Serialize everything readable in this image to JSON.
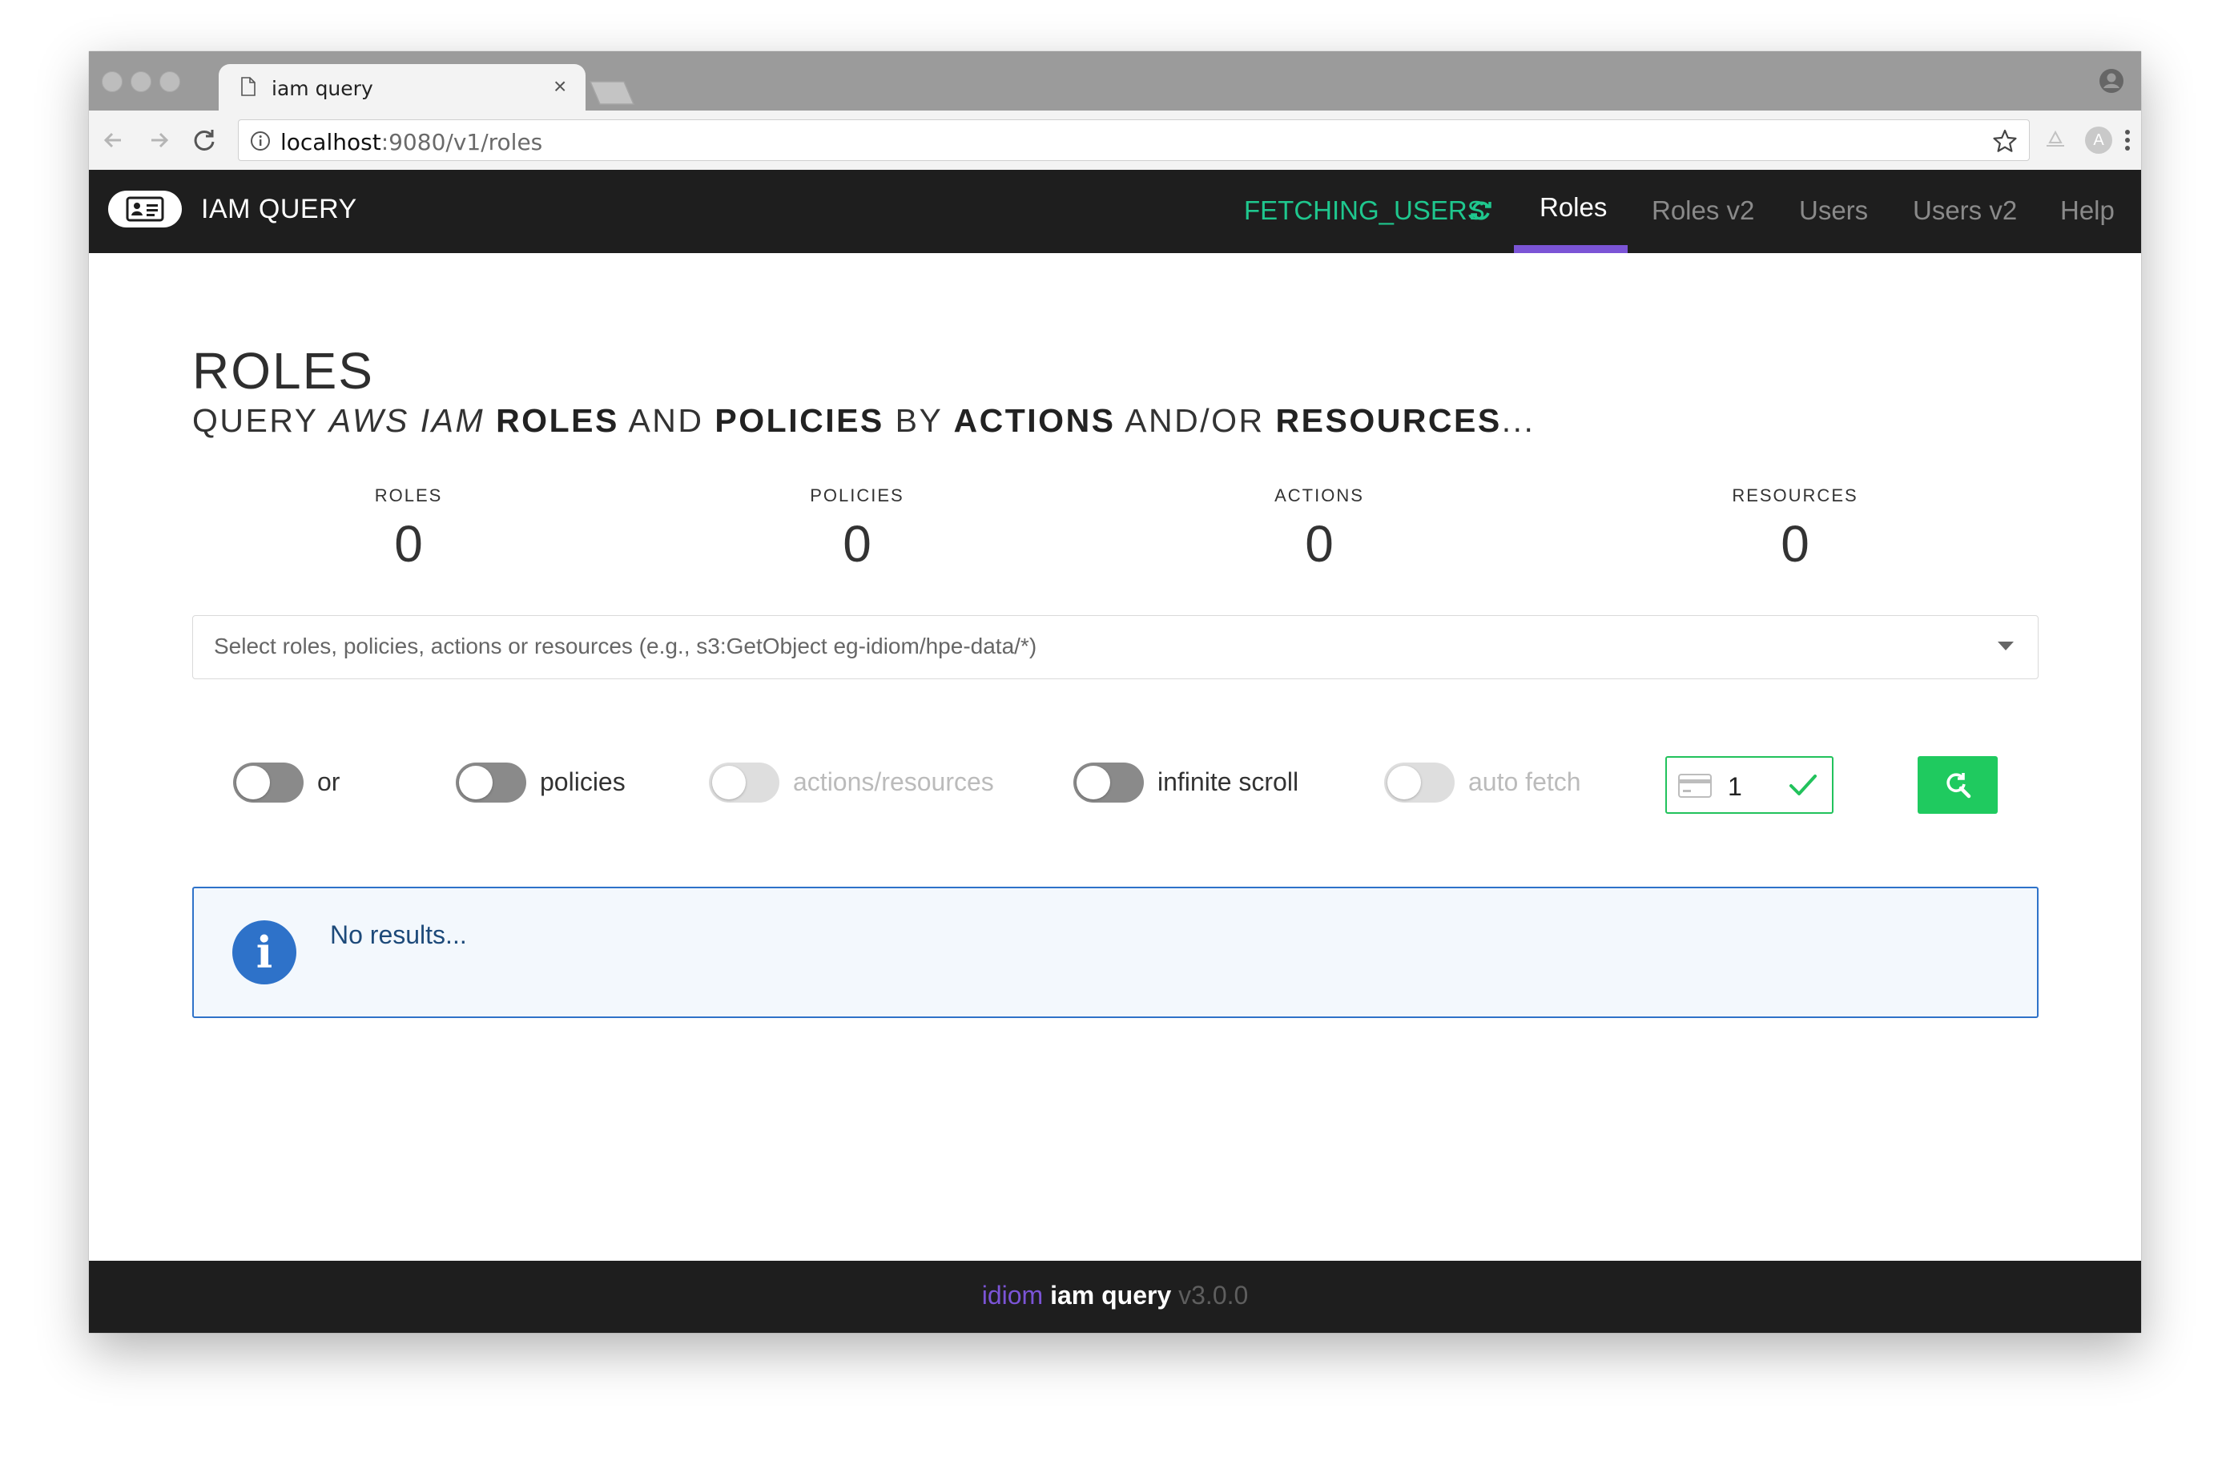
{
  "browser": {
    "tab_title": "iam query",
    "tab_close": "×",
    "url_host": "localhost",
    "url_path": ":9080/v1/roles",
    "profile_badge": "A"
  },
  "navbar": {
    "brand": "IAM QUERY",
    "status": "FETCHING_USERS",
    "items": [
      {
        "label": "Roles",
        "active": true
      },
      {
        "label": "Roles v2",
        "active": false
      },
      {
        "label": "Users",
        "active": false
      },
      {
        "label": "Users v2",
        "active": false
      },
      {
        "label": "Help",
        "active": false
      }
    ],
    "accent_color": "#7b54d6",
    "status_color": "#1fc78e"
  },
  "page": {
    "title": "ROLES",
    "subtitle": {
      "w1": "QUERY ",
      "w2": "AWS IAM",
      "w3": " ",
      "w4": "ROLES",
      "w5": " AND ",
      "w6": "POLICIES",
      "w7": " BY ",
      "w8": "ACTIONS",
      "w9": " AND/OR ",
      "w10": "RESOURCES",
      "w11": "..."
    }
  },
  "stats": [
    {
      "label": "ROLES",
      "value": "0"
    },
    {
      "label": "POLICIES",
      "value": "0"
    },
    {
      "label": "ACTIONS",
      "value": "0"
    },
    {
      "label": "RESOURCES",
      "value": "0"
    }
  ],
  "search": {
    "placeholder": "Select roles, policies, actions or resources (e.g., s3:GetObject eg-idiom/hpe-data/*)"
  },
  "toggles": [
    {
      "label": "or",
      "enabled": true,
      "on": false
    },
    {
      "label": "policies",
      "enabled": true,
      "on": false
    },
    {
      "label": "actions/resources",
      "enabled": false,
      "on": false
    },
    {
      "label": "infinite scroll",
      "enabled": true,
      "on": false
    },
    {
      "label": "auto fetch",
      "enabled": false,
      "on": false
    }
  ],
  "pagination": {
    "page_value": "1"
  },
  "message": {
    "text": "No results...",
    "icon": "i"
  },
  "footer": {
    "brand": "idiom",
    "name": "iam query",
    "version": "v3.0.0"
  },
  "colors": {
    "success": "#1fca5f",
    "info": "#2e72c9",
    "dark": "#1e1e1e"
  }
}
